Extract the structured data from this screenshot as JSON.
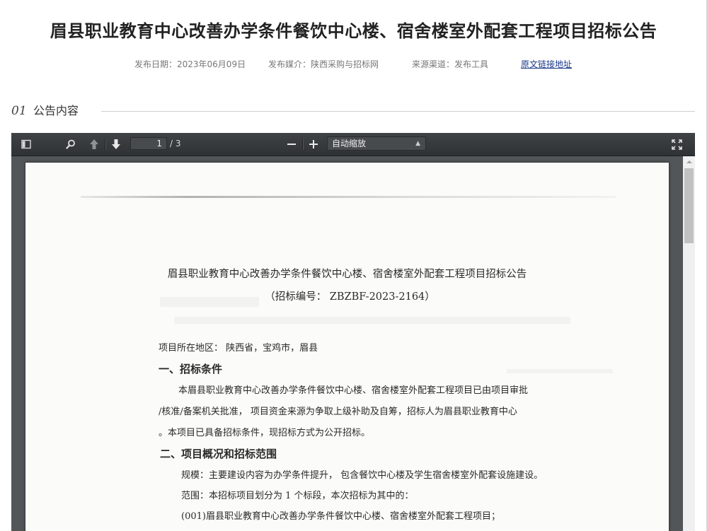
{
  "page": {
    "title": "眉县职业教育中心改善办学条件餐饮中心楼、宿舍楼室外配套工程项目招标公告",
    "meta": {
      "date": "发布日期：2023年06月09日",
      "media": "发布媒介：陕西采购与招标网",
      "channel": "来源渠道：发布工具",
      "link_text": "原文链接地址"
    }
  },
  "section": {
    "number": "01",
    "title": "公告内容"
  },
  "viewer": {
    "toolbar": {
      "sidebar_toggle": "sidebar-toggle-icon",
      "search": "search-icon",
      "prev": "arrow-up-icon",
      "next": "arrow-down-icon",
      "page_number": "1",
      "page_total": "/ 3",
      "zoom_out": "minus-icon",
      "zoom_in": "plus-icon",
      "zoom_value": "自动缩放",
      "fullscreen": "fullscreen-icon"
    },
    "document": {
      "title": "眉县职业教育中心改善办学条件餐饮中心楼、宿舍楼室外配套工程项目招标公告",
      "code": "（招标编号： ZBZBF-2023-2164）",
      "region": "项目所在地区：  陕西省，宝鸡市，眉县",
      "heading1": "一、招标条件",
      "para1_line1": "本眉县职业教育中心改善办学条件餐饮中心楼、宿舍楼室外配套工程项目已由项目审批",
      "para1_line2": "/核准/备案机关批准，  项目资金来源为争取上级补助及自筹，招标人为眉县职业教育中心",
      "para1_line3": "。本项目已具备招标条件，现招标方式为公开招标。",
      "heading2": "二、项目概况和招标范围",
      "scale": "规模：主要建设内容为办学条件提升，  包含餐饮中心楼及学生宿舍楼室外配套设施建设。",
      "scope": "范围：本招标项目划分为 1 个标段，本次招标为其中的：",
      "lot": "(001)眉县职业教育中心改善办学条件餐饮中心楼、宿舍楼室外配套工程项目；"
    }
  }
}
